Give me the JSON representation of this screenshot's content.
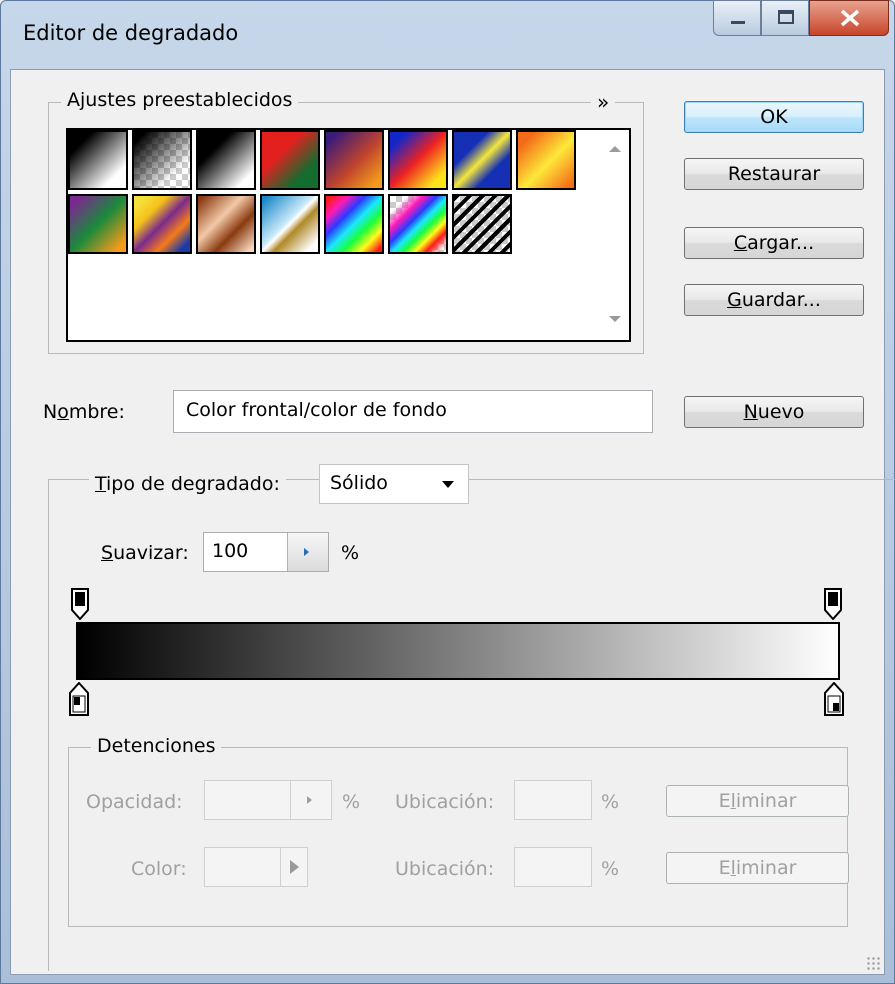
{
  "window": {
    "title": "Editor de degradado",
    "controls": [
      "minimize-icon",
      "maximize-icon",
      "close-icon"
    ]
  },
  "presets": {
    "legend": "Ajustes preestablecidos",
    "menu_glyph": "»",
    "swatches": [
      "black-white",
      "transparent-black",
      "black-white-2",
      "red-green",
      "violet-orange",
      "blue-red-yellow",
      "blue-yellow-blue",
      "orange-yellow-orange",
      "violet-green-orange",
      "yellow-violet-orange-blue",
      "copper",
      "chrome",
      "spectrum",
      "transparent-rainbow",
      "transparent-stripes"
    ]
  },
  "buttons": {
    "ok": "OK",
    "restore": "Restaurar",
    "load_prefix": "C",
    "load_rest": "argar...",
    "save_prefix": "G",
    "save_rest": "uardar...",
    "new_prefix": "N",
    "new_rest": "uevo"
  },
  "name": {
    "label_pre": "N",
    "label_ul": "o",
    "label_post": "mbre:",
    "value": "Color frontal/color de fondo"
  },
  "gradient": {
    "type_label_ul": "T",
    "type_label_rest": "ipo de degradado:",
    "type_value": "Sólido",
    "smooth_label_ul": "S",
    "smooth_label_rest": "uavizar:",
    "smooth_value": "100",
    "smooth_unit": "%",
    "start_color": "#000000",
    "end_color": "#ffffff"
  },
  "stops": {
    "legend": "Detenciones",
    "opacity_label": "Opacidad:",
    "opacity_unit": "%",
    "location_label": "Ubicación:",
    "location_unit": "%",
    "delete_pre": "E",
    "delete_ul": "l",
    "delete_post": "iminar",
    "color_label": "Color:",
    "location_label_2": "Ubicación:",
    "location_unit_2": "%"
  }
}
